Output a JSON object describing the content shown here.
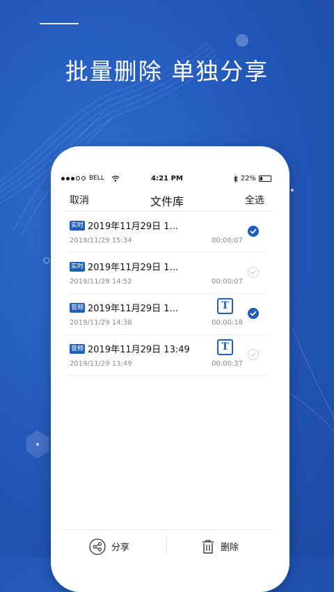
{
  "headline": "批量删除  单独分享",
  "status_bar": {
    "carrier": "BELL",
    "time": "4:21 PM",
    "battery": "22%",
    "battery_level": 0.22
  },
  "nav": {
    "cancel": "取消",
    "title": "文件库",
    "select_all": "全选"
  },
  "files": [
    {
      "tag": "实时",
      "title": "2019年11月29日 1...",
      "date": "2019/11/29 15:34",
      "duration": "00:00:07",
      "has_text": false,
      "checked": true
    },
    {
      "tag": "实时",
      "title": "2019年11月29日 1...",
      "date": "2019/11/29 14:52",
      "duration": "00:00:07",
      "has_text": false,
      "checked": false
    },
    {
      "tag": "音频",
      "title": "2019年11月29日 1...",
      "date": "2019/11/29 14:38",
      "duration": "00:00:18",
      "has_text": true,
      "checked": true
    },
    {
      "tag": "音频",
      "title": "2019年11月29日 13:49",
      "date": "2019/11/29 13:49",
      "duration": "00:00:37",
      "has_text": true,
      "checked": false
    }
  ],
  "text_icon_letter": "T",
  "bottom_bar": {
    "share": "分享",
    "delete": "删除"
  },
  "icons": {
    "share": "share-icon",
    "delete": "trash-icon",
    "check": "check-circle-icon",
    "text": "text-transcript-icon"
  },
  "colors": {
    "background": "#2257b8",
    "accent": "#1f5fb8",
    "text": "#222222",
    "muted": "#888888"
  }
}
